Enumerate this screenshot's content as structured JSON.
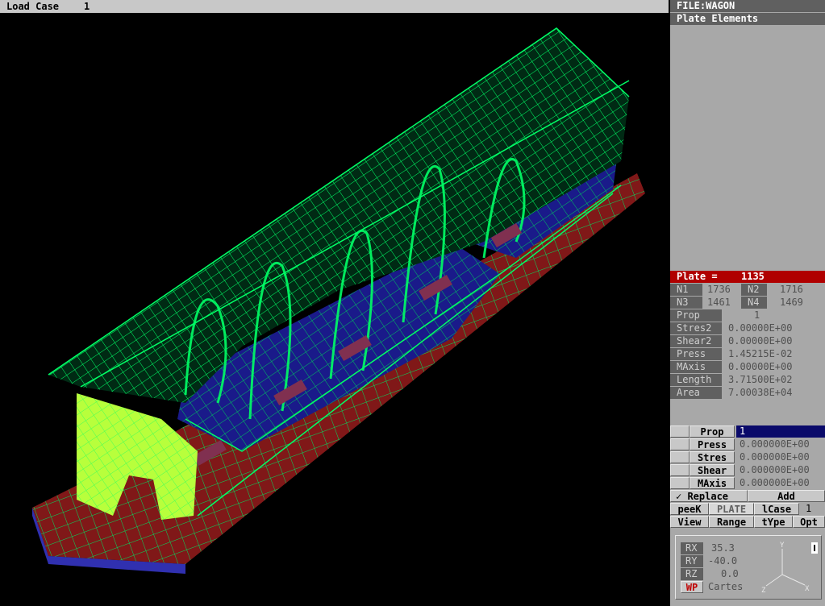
{
  "top": {
    "label": "Load Case",
    "value": "1"
  },
  "panel": {
    "file": "FILE:WAGON",
    "section": "Plate Elements",
    "plate_label": "Plate =",
    "plate_value": "1135",
    "nodes": [
      {
        "label": "N1",
        "value": "1736"
      },
      {
        "label": "N2",
        "value": "1716"
      },
      {
        "label": "N3",
        "value": "1461"
      },
      {
        "label": "N4",
        "value": "1469"
      }
    ],
    "props": [
      {
        "label": "Prop",
        "value": "1"
      },
      {
        "label": "Stres2",
        "value": "0.00000E+00"
      },
      {
        "label": "Shear2",
        "value": "0.00000E+00"
      },
      {
        "label": "Press",
        "value": "1.45215E-02"
      },
      {
        "label": "MAxis",
        "value": "0.00000E+00"
      },
      {
        "label": "Length",
        "value": "3.71500E+02"
      },
      {
        "label": "Area",
        "value": "7.00038E+04"
      }
    ],
    "edit": [
      {
        "label": "Prop",
        "value": "1"
      },
      {
        "label": "Press",
        "value": "0.000000E+00"
      },
      {
        "label": "Stres",
        "value": "0.000000E+00"
      },
      {
        "label": "Shear",
        "value": "0.000000E+00"
      },
      {
        "label": "MAxis",
        "value": "0.000000E+00"
      }
    ],
    "replace_label": "✓ Replace",
    "add_label": "Add",
    "row1": {
      "peek": "peeK",
      "plate": "PLATE",
      "lcase": "lCase",
      "lcase_value": "1"
    },
    "row2": {
      "view": "View",
      "range": "Range",
      "type": "tYpe",
      "opt": "Opt"
    },
    "rot": {
      "rx_label": "RX",
      "rx": "35.3",
      "ry_label": "RY",
      "ry": "-40.0",
      "rz_label": "RZ",
      "rz": "0.0",
      "wp_label": "WP",
      "coord": "Cartes",
      "axes": [
        "Y",
        "X",
        "Z"
      ]
    }
  },
  "colors": {
    "mesh": "#00ff66",
    "wall": "#b8ff3c",
    "blue": "#1a1a8a",
    "floor": "#801818",
    "selected": "#b00000"
  }
}
